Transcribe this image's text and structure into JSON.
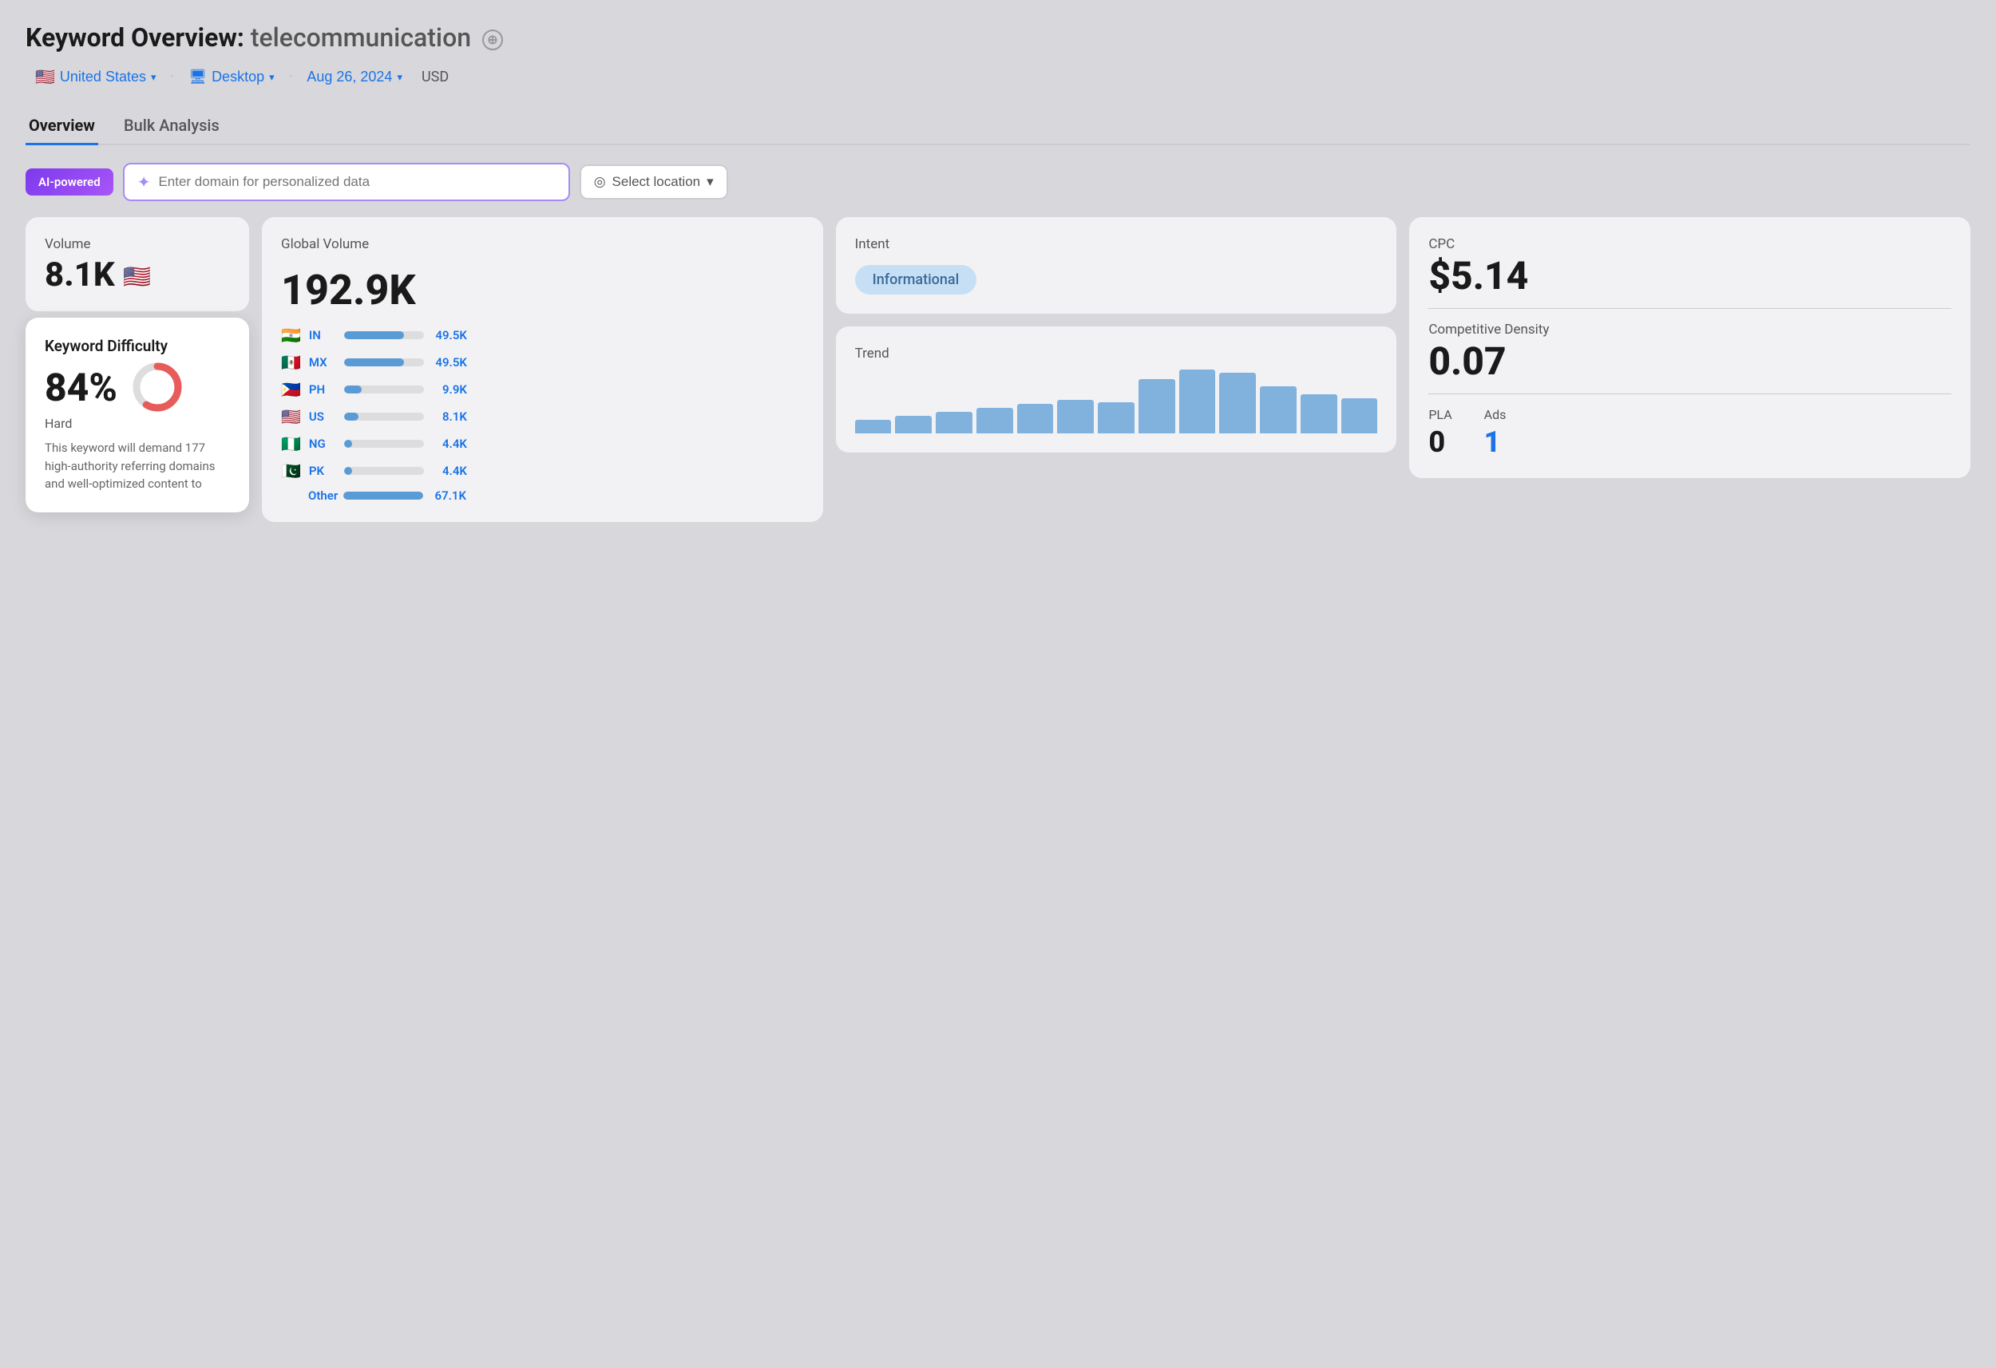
{
  "header": {
    "title_prefix": "Keyword Overview:",
    "keyword": "telecommunication",
    "add_icon": "⊕"
  },
  "filters": {
    "country_flag": "🇺🇸",
    "country_label": "United States",
    "device_icon": "🖥",
    "device_label": "Desktop",
    "date_label": "Aug 26, 2024",
    "currency_label": "USD"
  },
  "tabs": [
    {
      "label": "Overview",
      "active": true
    },
    {
      "label": "Bulk Analysis",
      "active": false
    }
  ],
  "ai_search": {
    "badge_label": "AI-powered",
    "input_placeholder": "Enter domain for personalized data",
    "location_placeholder": "Select location"
  },
  "volume_card": {
    "label": "Volume",
    "value": "8.1K",
    "flag": "🇺🇸"
  },
  "kd_card": {
    "label": "Keyword Difficulty",
    "percent": "84%",
    "level": "Hard",
    "description": "This keyword will demand 177 high-authority referring domains and well-optimized content to",
    "donut_filled": 84,
    "donut_color": "#e85b5b",
    "donut_bg": "#ddd"
  },
  "global_volume_card": {
    "label": "Global Volume",
    "value": "192.9K",
    "countries": [
      {
        "flag": "🇮🇳",
        "code": "IN",
        "value": "49.5K",
        "bar_pct": 75
      },
      {
        "flag": "🇲🇽",
        "code": "MX",
        "value": "49.5K",
        "bar_pct": 75
      },
      {
        "flag": "🇵🇭",
        "code": "PH",
        "value": "9.9K",
        "bar_pct": 22
      },
      {
        "flag": "🇺🇸",
        "code": "US",
        "value": "8.1K",
        "bar_pct": 18
      },
      {
        "flag": "🇳🇬",
        "code": "NG",
        "value": "4.4K",
        "bar_pct": 10
      },
      {
        "flag": "🇵🇰",
        "code": "PK",
        "value": "4.4K",
        "bar_pct": 10
      },
      {
        "flag": "",
        "code": "Other",
        "value": "67.1K",
        "bar_pct": 100,
        "no_flag": true
      }
    ]
  },
  "intent_card": {
    "label": "Intent",
    "badge": "Informational"
  },
  "trend_card": {
    "label": "Trend",
    "bars": [
      14,
      18,
      22,
      26,
      30,
      34,
      32,
      55,
      65,
      62,
      48,
      40,
      36
    ]
  },
  "cpc_card": {
    "cpc_label": "CPC",
    "cpc_value": "$5.14",
    "cd_label": "Competitive Density",
    "cd_value": "0.07",
    "pla_label": "PLA",
    "pla_value": "0",
    "ads_label": "Ads",
    "ads_value": "1"
  }
}
